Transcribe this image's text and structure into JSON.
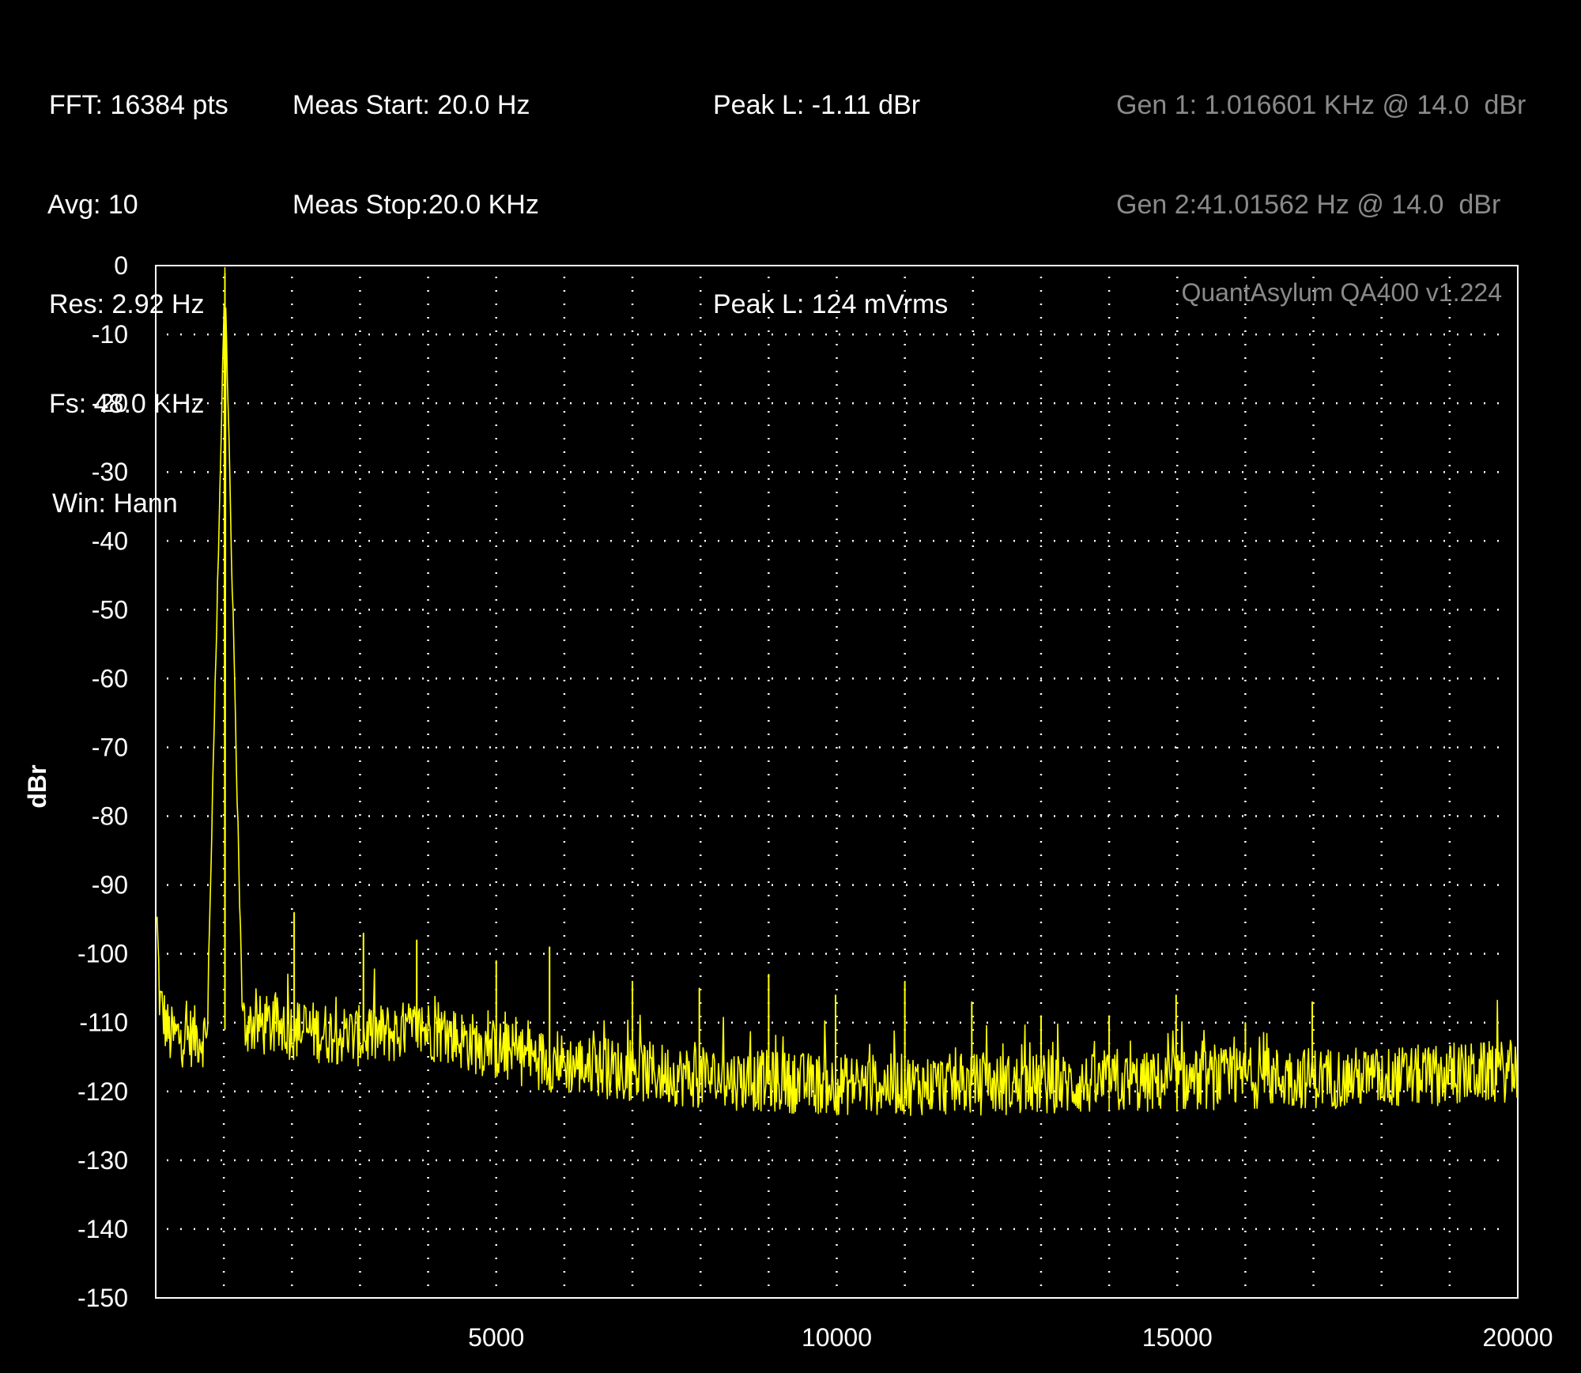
{
  "header": {
    "col1": [
      "FFT: 16384 pts",
      "Avg: 10",
      "Res: 2.92 Hz",
      "Fs: 48.0 KHz",
      "Win: Hann"
    ],
    "col2": [
      "Meas Start: 20.0 Hz",
      "Meas Stop:20.0 KHz"
    ],
    "col3_line1": "Peak L: -1.11 dBr",
    "col3_line2": "Peak L: 124 mVrms",
    "gen1": "Gen 1: 1.016601 KHz @ 14.0  dBr",
    "gen2": "Gen 2:41.01562 Hz @ 14.0  dBr"
  },
  "colors": {
    "background": "#000000",
    "trace": "#ffff00",
    "grid": "#ffffff",
    "text": "#ffffff",
    "muted_text": "#8a8a8a"
  },
  "chart_data": {
    "type": "line",
    "watermark": "QuantAsylum QA400 v1.224",
    "ylabel": "dBr",
    "xlabel": "",
    "xlim": [
      0,
      20000
    ],
    "ylim": [
      -150,
      0
    ],
    "x_ticks": [
      5000,
      10000,
      15000,
      20000
    ],
    "x_tick_labels": [
      "5000",
      "10000",
      "15000",
      "20000"
    ],
    "y_ticks": [
      0,
      -10,
      -20,
      -30,
      -40,
      -50,
      -60,
      -70,
      -80,
      -90,
      -100,
      -110,
      -120,
      -130,
      -140,
      -150
    ],
    "y_tick_labels": [
      "0",
      "-10",
      "-20",
      "-30",
      "-40",
      "-50",
      "-60",
      "-70",
      "-80",
      "-90",
      "-100",
      "-110",
      "-120",
      "-130",
      "-140",
      "-150"
    ],
    "grid": true,
    "series": [
      {
        "color": "#ffff00",
        "noise_floor": [
          [
            20,
            -96
          ],
          [
            60,
            -107
          ],
          [
            200,
            -112
          ],
          [
            800,
            -112
          ],
          [
            1016,
            -111
          ],
          [
            1200,
            -110
          ],
          [
            2000,
            -111
          ],
          [
            3000,
            -112
          ],
          [
            4000,
            -111
          ],
          [
            5000,
            -114
          ],
          [
            6000,
            -116
          ],
          [
            7000,
            -117
          ],
          [
            8000,
            -118
          ],
          [
            10000,
            -119
          ],
          [
            12000,
            -119
          ],
          [
            14000,
            -119
          ],
          [
            16000,
            -118
          ],
          [
            18000,
            -118
          ],
          [
            20000,
            -117
          ]
        ],
        "peaks": [
          {
            "x": 1016,
            "y": -1.1
          },
          {
            "x": 2033,
            "y": -94
          },
          {
            "x": 3050,
            "y": -97
          },
          {
            "x": 3833,
            "y": -98
          },
          {
            "x": 5000,
            "y": -101
          },
          {
            "x": 5783,
            "y": -99
          },
          {
            "x": 7000,
            "y": -104
          },
          {
            "x": 7983,
            "y": -105
          },
          {
            "x": 9000,
            "y": -103
          },
          {
            "x": 9983,
            "y": -106
          },
          {
            "x": 11000,
            "y": -104
          },
          {
            "x": 11983,
            "y": -107
          },
          {
            "x": 13000,
            "y": -109
          },
          {
            "x": 14000,
            "y": -109
          },
          {
            "x": 14983,
            "y": -106
          },
          {
            "x": 16000,
            "y": -110
          },
          {
            "x": 16983,
            "y": -107
          }
        ]
      }
    ]
  }
}
